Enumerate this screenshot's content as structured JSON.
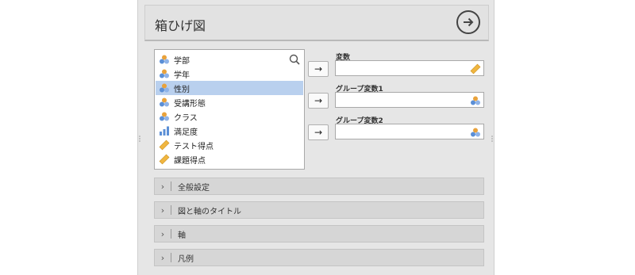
{
  "header": {
    "title": "箱ひげ図",
    "run_icon": "arrow-right-circle-icon"
  },
  "variables": [
    {
      "name": "学部",
      "type": "nominal",
      "selected": false
    },
    {
      "name": "学年",
      "type": "nominal",
      "selected": false
    },
    {
      "name": "性別",
      "type": "nominal",
      "selected": true
    },
    {
      "name": "受講形態",
      "type": "nominal",
      "selected": false
    },
    {
      "name": "クラス",
      "type": "nominal",
      "selected": false
    },
    {
      "name": "満足度",
      "type": "ordinal",
      "selected": false
    },
    {
      "name": "テスト得点",
      "type": "continuous",
      "selected": false
    },
    {
      "name": "課題得点",
      "type": "continuous",
      "selected": false
    }
  ],
  "targets": [
    {
      "label": "変数",
      "value": "",
      "icon": "ruler-icon"
    },
    {
      "label": "グループ変数1",
      "value": "",
      "icon": "nominal-icon"
    },
    {
      "label": "グループ変数2",
      "value": "",
      "icon": "nominal-icon"
    }
  ],
  "move_label": "→",
  "sections": [
    {
      "label": "全般設定"
    },
    {
      "label": "図と軸のタイトル"
    },
    {
      "label": "軸"
    },
    {
      "label": "凡例"
    }
  ],
  "colors": {
    "selected_row": "#b9d0ee",
    "nominal_orange": "#e9a23b",
    "nominal_blue": "#5b8fd6",
    "ruler": "#f0b640"
  }
}
